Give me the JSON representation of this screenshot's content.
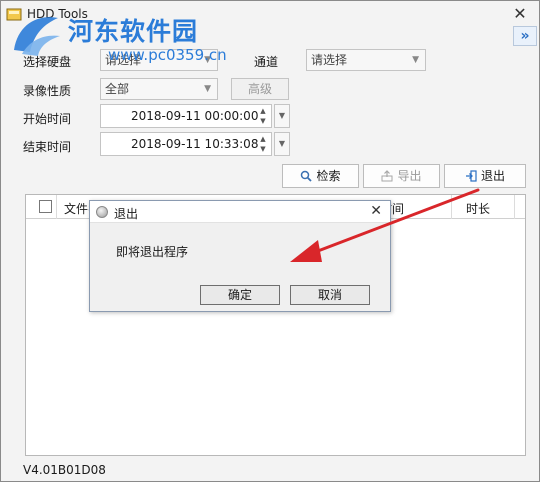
{
  "window": {
    "title": "HDD Tools"
  },
  "watermark": {
    "title": "河东软件园",
    "url": "www.pc0359.cn"
  },
  "form": {
    "disk_label": "选择硬盘",
    "disk_value": "请选择",
    "channel_label": "通道",
    "channel_placeholder": "请选择",
    "record_type_label": "录像性质",
    "record_type_value": "全部",
    "advanced_label": "高级",
    "start_label": "开始时间",
    "start_value": "2018-09-11 00:00:00",
    "end_label": "结束时间",
    "end_value": "2018-09-11 10:33:08"
  },
  "toolbar": {
    "search_label": "检索",
    "export_label": "导出",
    "exit_label": "退出"
  },
  "table": {
    "columns": [
      "文件名",
      "时间",
      "时长"
    ]
  },
  "dialog": {
    "title": "退出",
    "message": "即将退出程序",
    "ok_label": "确定",
    "cancel_label": "取消"
  },
  "footer": {
    "version": "V4.01B01D08"
  },
  "colors": {
    "accent": "#2b7cd8",
    "annotation_arrow": "#d9262a"
  }
}
